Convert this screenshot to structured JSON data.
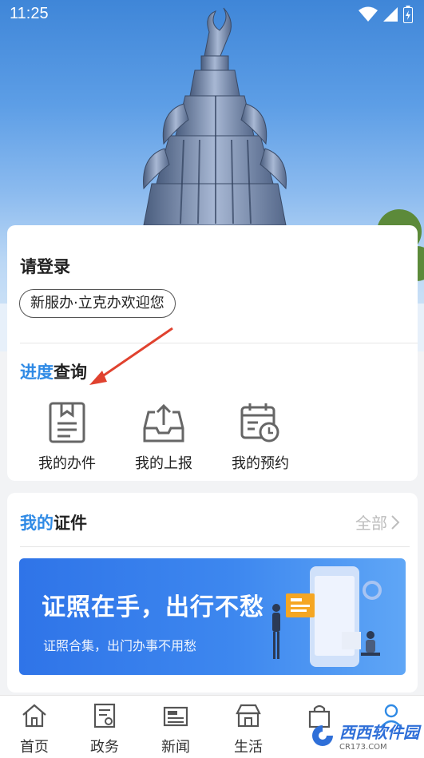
{
  "status_bar": {
    "time": "11:25"
  },
  "login": {
    "title": "请登录",
    "welcome": "新服办·立克办欢迎您"
  },
  "progress": {
    "title_accent": "进度",
    "title_rest": "查询",
    "shortcuts": [
      {
        "label": "我的办件",
        "icon": "document-bookmark-icon"
      },
      {
        "label": "我的上报",
        "icon": "upload-tray-icon"
      },
      {
        "label": "我的预约",
        "icon": "calendar-clock-icon"
      }
    ]
  },
  "certificates": {
    "title_accent": "我的",
    "title_rest": "证件",
    "all_label": "全部",
    "banner": {
      "title": "证照在手，出行不愁",
      "subtitle": "证照合集，出门办事不用愁"
    }
  },
  "tabs": [
    {
      "label": "首页",
      "icon": "home-icon"
    },
    {
      "label": "政务",
      "icon": "government-doc-icon"
    },
    {
      "label": "新闻",
      "icon": "newspaper-icon"
    },
    {
      "label": "生活",
      "icon": "shop-icon"
    },
    {
      "label": "",
      "icon": "shopping-bag-icon"
    },
    {
      "label": "",
      "icon": "user-icon"
    }
  ],
  "watermark": {
    "text": "西西软件园",
    "sub": "CR173.COM"
  },
  "colors": {
    "accent": "#2f8ae5",
    "banner_start": "#2f74e8",
    "banner_end": "#5fa6f6",
    "annotation_arrow": "#e0422f"
  }
}
